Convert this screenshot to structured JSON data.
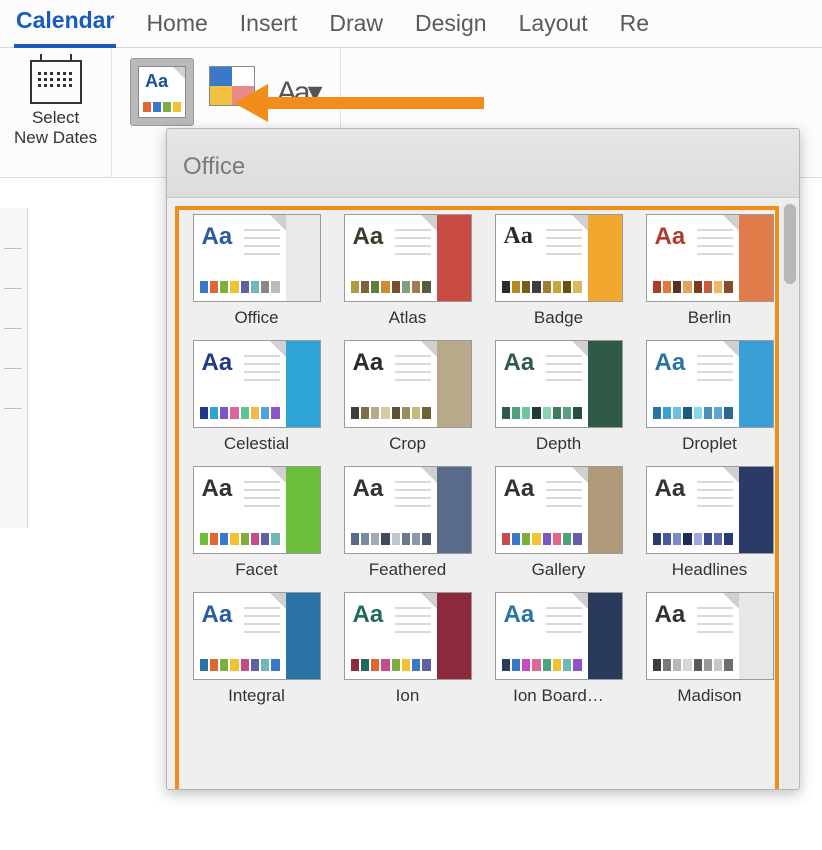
{
  "tabs": {
    "items": [
      {
        "label": "Calendar",
        "active": true
      },
      {
        "label": "Home",
        "active": false
      },
      {
        "label": "Insert",
        "active": false
      },
      {
        "label": "Draw",
        "active": false
      },
      {
        "label": "Design",
        "active": false
      },
      {
        "label": "Layout",
        "active": false
      },
      {
        "label": "Re",
        "active": false
      }
    ]
  },
  "ribbon": {
    "select_new_dates": {
      "line1": "Select",
      "line2": "New Dates"
    },
    "fonts_button_glyph": "Aa▾"
  },
  "themes_dropdown": {
    "section_title": "Office",
    "themes": [
      {
        "label": "Office",
        "aa_color": "#2a5aa0",
        "side_color": "#e9e9e9",
        "swatches": [
          "#3a79c9",
          "#e06633",
          "#7fae3e",
          "#f1c232",
          "#5f5fa7",
          "#6fb8b8",
          "#888888",
          "#bbbbbb"
        ]
      },
      {
        "label": "Atlas",
        "aa_color": "#3b3b2a",
        "side_color": "#c84b44",
        "swatches": [
          "#b39a44",
          "#7d623c",
          "#5f7d3c",
          "#c98f2e",
          "#7a4f2a",
          "#7da07d",
          "#a07d4f",
          "#5a5a3c"
        ]
      },
      {
        "label": "Badge",
        "aa_color": "#2b2b2b",
        "side_color": "#f2a72e",
        "swatches": [
          "#2b2b2b",
          "#b58a22",
          "#7a5b15",
          "#3e3e3e",
          "#9a7f2e",
          "#c7a63b",
          "#6d5012",
          "#d7b95a"
        ],
        "font": "Georgia, serif"
      },
      {
        "label": "Berlin",
        "aa_color": "#b03a2e",
        "side_color": "#e07b4a",
        "swatches": [
          "#b03a2e",
          "#dd7a33",
          "#5c2e1e",
          "#e0a45a",
          "#7a3a1e",
          "#c95c3b",
          "#f0b76a",
          "#8a4a2e"
        ]
      },
      {
        "label": "Celestial",
        "aa_color": "#1f3a8a",
        "side_color": "#2fa5d6",
        "swatches": [
          "#1f3a8a",
          "#2fa5d6",
          "#7b55c7",
          "#e06699",
          "#55c78f",
          "#f0b945",
          "#4aa3e0",
          "#8a55c7"
        ]
      },
      {
        "label": "Crop",
        "aa_color": "#2b2b2b",
        "side_color": "#b7a98a",
        "swatches": [
          "#3e3e3e",
          "#7a6f4a",
          "#b7a98a",
          "#d7c9a0",
          "#5a5236",
          "#9a8c5e",
          "#c7b87e",
          "#6e623a"
        ]
      },
      {
        "label": "Depth",
        "aa_color": "#2f5a47",
        "side_color": "#2f5a47",
        "swatches": [
          "#2f5a47",
          "#4aa37d",
          "#6fc79a",
          "#1f3a30",
          "#8ad4b2",
          "#3e7a5f",
          "#5aa080",
          "#2a4f3e"
        ]
      },
      {
        "label": "Droplet",
        "aa_color": "#2a74a5",
        "side_color": "#3a9fd6",
        "swatches": [
          "#2a74a5",
          "#3a9fd6",
          "#6fc0e0",
          "#1f5a7d",
          "#8ad4ee",
          "#4a8fb7",
          "#5aa8cc",
          "#2a6a8f"
        ]
      },
      {
        "label": "Facet",
        "aa_color": "#333333",
        "side_color": "#6bbf3a",
        "swatches": [
          "#6bbf3a",
          "#e06633",
          "#3a79c9",
          "#f1c232",
          "#7fae3e",
          "#c74b8a",
          "#5f5fa7",
          "#6fb8b8"
        ]
      },
      {
        "label": "Feathered",
        "aa_color": "#333333",
        "side_color": "#5a6a8a",
        "swatches": [
          "#5a6a8a",
          "#7a8aa0",
          "#a0aabb",
          "#3e4a60",
          "#c0c7d2",
          "#6a7a90",
          "#8a98aa",
          "#4a5a74"
        ]
      },
      {
        "label": "Gallery",
        "aa_color": "#333333",
        "side_color": "#b09a7a",
        "swatches": [
          "#c74b4b",
          "#3a79c9",
          "#7fae3e",
          "#f1c232",
          "#7b55c7",
          "#e0668a",
          "#4aa37d",
          "#5f5fa7"
        ]
      },
      {
        "label": "Headlines",
        "aa_color": "#333333",
        "side_color": "#2b3a66",
        "swatches": [
          "#2b3a66",
          "#4a5aa0",
          "#7a8ac9",
          "#1f2a50",
          "#9aaade",
          "#3e4a8a",
          "#5a6ab2",
          "#2a3a74"
        ]
      },
      {
        "label": "Integral",
        "aa_color": "#2a5aa0",
        "side_color": "#2a74a5",
        "swatches": [
          "#2a74a5",
          "#e06633",
          "#7fae3e",
          "#f1c232",
          "#c74b8a",
          "#5f5fa7",
          "#6fb8b8",
          "#3a79c9"
        ]
      },
      {
        "label": "Ion",
        "aa_color": "#1f6a5a",
        "side_color": "#8a2a3a",
        "swatches": [
          "#8a2a3a",
          "#1f6a5a",
          "#e06633",
          "#c74b8a",
          "#7fae3e",
          "#f1c232",
          "#3a79c9",
          "#5f5fa7"
        ]
      },
      {
        "label": "Ion Board…",
        "aa_color": "#2a74a5",
        "side_color": "#2a3a5a",
        "swatches": [
          "#2a3a5a",
          "#3a79c9",
          "#c74bc7",
          "#e06699",
          "#4aa37d",
          "#f1c232",
          "#6fb8b8",
          "#8a55c7"
        ]
      },
      {
        "label": "Madison",
        "aa_color": "#333333",
        "side_color": "#e7e7e7",
        "swatches": [
          "#3e3e3e",
          "#7a7a7a",
          "#b7b7b7",
          "#d7d7d7",
          "#5a5a5a",
          "#9a9a9a",
          "#c7c7c7",
          "#6e6e6e"
        ]
      }
    ]
  }
}
